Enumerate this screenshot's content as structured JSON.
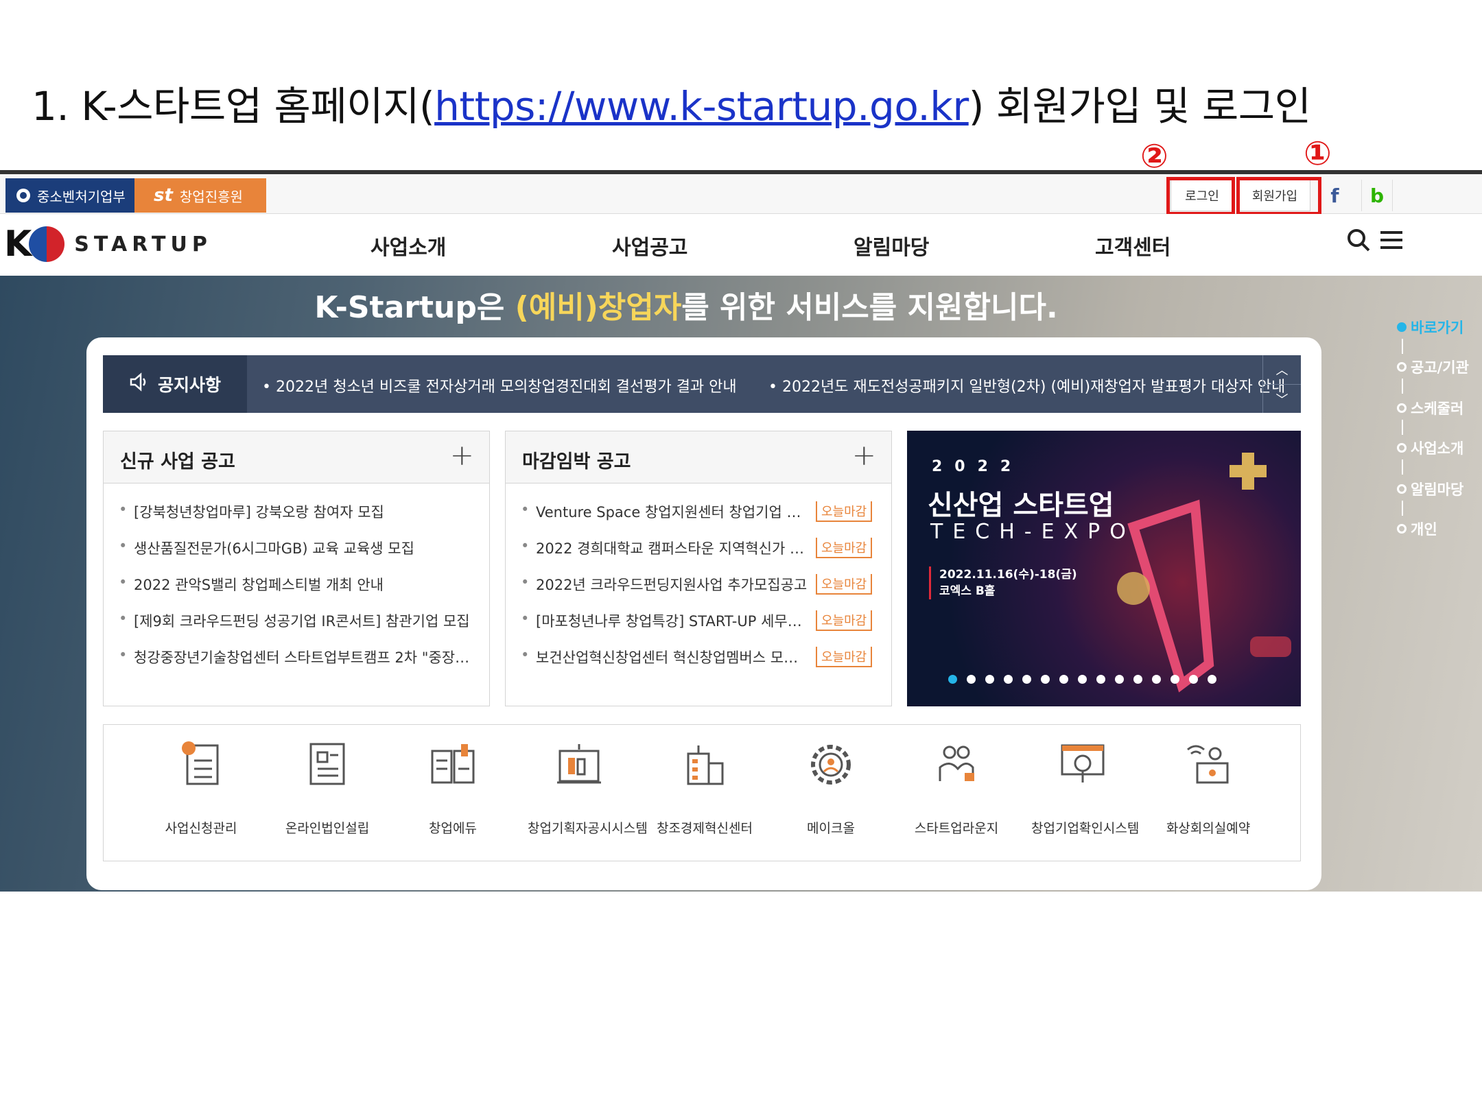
{
  "slide": {
    "title_prefix": "1. K-스타트업 홈페이지(",
    "title_url": "https://www.k-startup.go.kr",
    "title_suffix": ") 회원가입 및 로그인",
    "marker_login": "②",
    "marker_signup": "①"
  },
  "topbar": {
    "gov_label": "중소벤처기업부",
    "kised_logo": "st",
    "kised_label": "창업진흥원",
    "login": "로그인",
    "signup": "회원가입",
    "facebook": "f",
    "blog": "b"
  },
  "header": {
    "logo_k": "K",
    "logo_text": "STARTUP",
    "nav": [
      "사업소개",
      "사업공고",
      "알림마당",
      "고객센터"
    ],
    "search_icon": "search-icon",
    "menu_icon": "hamburger-menu-icon"
  },
  "hero": {
    "title_a": "K-Startup은 ",
    "title_hl": "(예비)창업자",
    "title_b": "를 위한 서비스를 지원합니다."
  },
  "quick_menu": [
    "바로가기",
    "공고/기관",
    "스케줄러",
    "사업소개",
    "알림마당",
    "개인"
  ],
  "notice": {
    "label": "공지사항",
    "items": [
      "2022년 청소년 비즈쿨 전자상거래 모의창업경진대회 결선평가 결과 안내",
      "2022년도 재도전성공패키지 일반형(2차) (예비)재창업자 발표평가 대상자 안내"
    ]
  },
  "new_business": {
    "title": "신규 사업 공고",
    "items": [
      "[강북청년창업마루] 강북오랑 참여자 모집",
      "생산품질전문가(6시그마GB) 교육 교육생 모집",
      "2022 관악S밸리 창업페스티벌 개최 안내",
      "[제9회 크라우드펀딩 성공기업 IR콘서트] 참관기업 모집",
      "청강중장년기술창업센터 스타트업부트캠프 2차 \"중장년…"
    ]
  },
  "deadline": {
    "title": "마감임박 공고",
    "tag": "오늘마감",
    "items": [
      "Venture Space 창업지원센터 창업기업 입…",
      "2022 경희대학교 캠퍼스타운 지역혁신가 에…",
      "2022년 크라우드펀딩지원사업 추가모집공고",
      "[마포청년나루 창업특강] START-UP 세무회…",
      "보건산업혁신창업센터 혁신창업멤버스 모집…"
    ]
  },
  "banner": {
    "year": "2022",
    "title": "신산업 스타트업",
    "subtitle": "TECH-EXPO",
    "date": "2022.11.16(수)-18(금)",
    "venue": "코엑스 B홀"
  },
  "services": [
    {
      "label": "사업신청관리",
      "icon": "checklist-icon"
    },
    {
      "label": "온라인법인설립",
      "icon": "document-icon"
    },
    {
      "label": "창업에듀",
      "icon": "book-icon"
    },
    {
      "label": "창업기획자공시시스템",
      "icon": "board-icon"
    },
    {
      "label": "창조경제혁신센터",
      "icon": "building-icon"
    },
    {
      "label": "메이크올",
      "icon": "gear-icon"
    },
    {
      "label": "스타트업라운지",
      "icon": "people-icon"
    },
    {
      "label": "창업기업확인시스템",
      "icon": "magnifier-icon"
    },
    {
      "label": "화상회의실예약",
      "icon": "video-meeting-icon"
    }
  ],
  "colors": {
    "gov_blue": "#1b3d7a",
    "kised_orange": "#e8843a",
    "notice_navy": "#3f4d66",
    "quick_active": "#25b5e8",
    "annotation_red": "#e01818"
  }
}
